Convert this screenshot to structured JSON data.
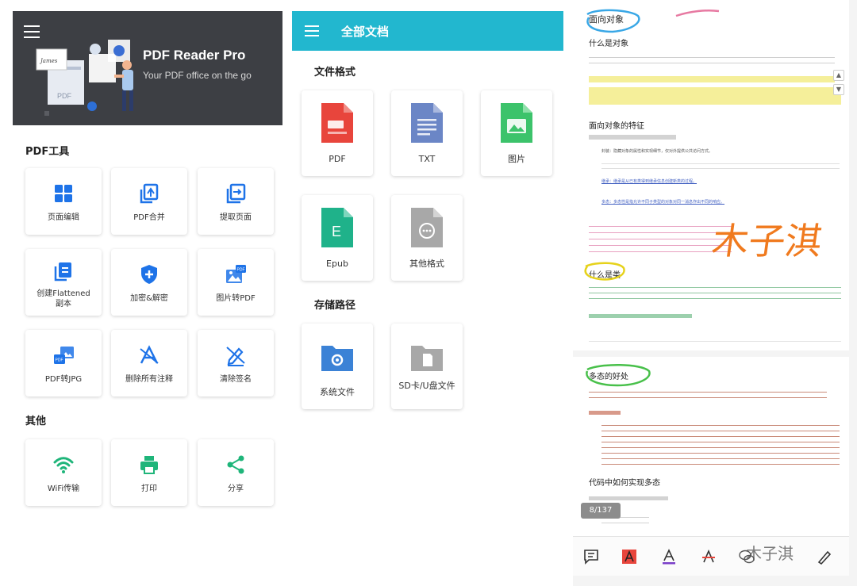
{
  "left": {
    "banner": {
      "title": "PDF Reader Pro",
      "subtitle": "Your PDF office on the go",
      "doc_label": "PDF",
      "signature": "James"
    },
    "pdf_tools_title": "PDF工具",
    "tools": [
      {
        "label": "页面编辑",
        "icon": "grid-icon"
      },
      {
        "label": "PDF合并",
        "icon": "merge-icon"
      },
      {
        "label": "提取页面",
        "icon": "extract-icon"
      },
      {
        "label": "创建Flattened\n副本",
        "icon": "flatten-icon"
      },
      {
        "label": "加密&解密",
        "icon": "shield-plus-icon"
      },
      {
        "label": "图片转PDF",
        "icon": "image-to-pdf-icon"
      },
      {
        "label": "PDF转JPG",
        "icon": "pdf-to-jpg-icon"
      },
      {
        "label": "删除所有注释",
        "icon": "delete-annotations-icon"
      },
      {
        "label": "清除签名",
        "icon": "clear-signature-icon"
      }
    ],
    "other_title": "其他",
    "others": [
      {
        "label": "WiFi传输",
        "icon": "wifi-icon"
      },
      {
        "label": "打印",
        "icon": "printer-icon"
      },
      {
        "label": "分享",
        "icon": "share-icon"
      }
    ]
  },
  "middle": {
    "title": "全部文档",
    "formats_title": "文件格式",
    "formats": [
      {
        "label": "PDF",
        "color": "#e8453c"
      },
      {
        "label": "TXT",
        "color": "#6b86c6"
      },
      {
        "label": "图片",
        "color": "#3cc36b"
      },
      {
        "label": "Epub",
        "color": "#1fb28a",
        "letter": "E"
      },
      {
        "label": "其他格式",
        "color": "#a8a8a8"
      }
    ],
    "storage_title": "存储路径",
    "storage": [
      {
        "label": "系统文件",
        "color": "#3b82d6"
      },
      {
        "label": "SD卡/U盘文件",
        "color": "#a8a8a8"
      }
    ]
  },
  "right": {
    "heading_oop": "面向对象",
    "heading_what_object": "什么是对象",
    "heading_features": "面向对象的特征",
    "heading_what_class": "什么是类",
    "heading_poly_benefit": "多态的好处",
    "heading_implement": "代码中如何实现多态",
    "handwriting": "木子淇",
    "page_indicator": "8/137",
    "watermark": "木子淇",
    "bullet_1": "封装：隐藏对象的属性和实现细节，仅对外提供公共访问方式。",
    "bullet_2": "继承：继承是从已有类得到继承信息创建新类的过程。",
    "bullet_3": "多态：多态性是指允许不同子类型的对象对同一消息作出不同的响应。",
    "accent": "#22b7cf"
  }
}
